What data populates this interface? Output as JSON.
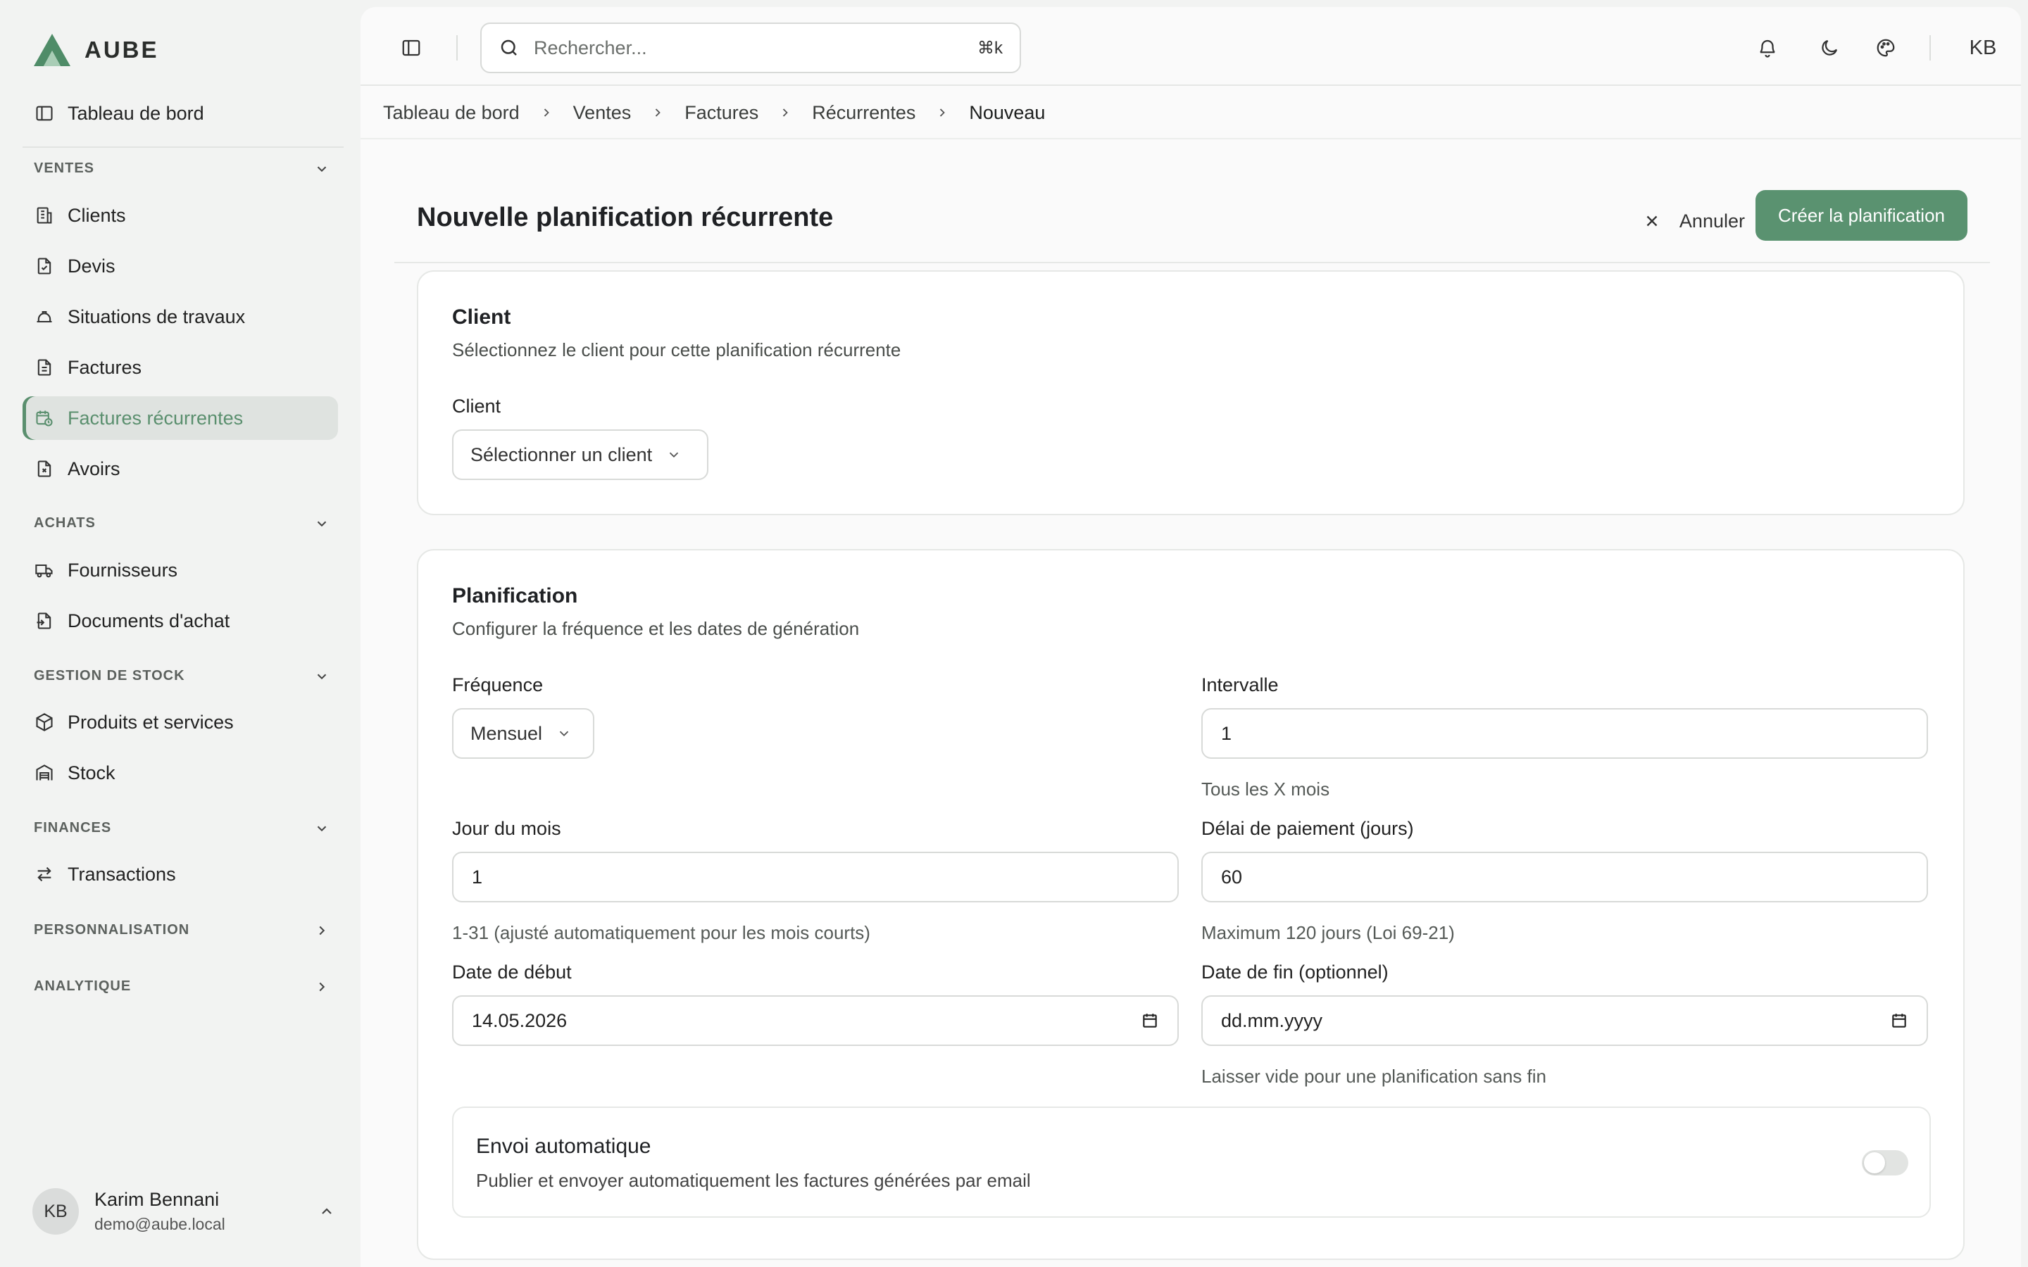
{
  "app": {
    "logo_text": "AUBE",
    "accent": "#5a9270"
  },
  "sidebar": {
    "top_item": "Tableau de bord",
    "sections": {
      "ventes": "VENTES",
      "achats": "ACHATS",
      "stock": "GESTION DE STOCK",
      "finances": "FINANCES",
      "perso": "PERSONNALISATION",
      "analytique": "ANALYTIQUE"
    },
    "items": {
      "clients": "Clients",
      "devis": "Devis",
      "situations": "Situations de travaux",
      "factures": "Factures",
      "recurrentes": "Factures récurrentes",
      "avoirs": "Avoirs",
      "fournisseurs": "Fournisseurs",
      "documents": "Documents d'achat",
      "produits": "Produits et services",
      "stock": "Stock",
      "transactions": "Transactions"
    },
    "user": {
      "initials": "KB",
      "name": "Karim Bennani",
      "email": "demo@aube.local"
    }
  },
  "topbar": {
    "search_placeholder": "Rechercher...",
    "shortcut": "⌘k",
    "user_initials": "KB"
  },
  "breadcrumb": [
    "Tableau de bord",
    "Ventes",
    "Factures",
    "Récurrentes",
    "Nouveau"
  ],
  "page": {
    "title": "Nouvelle planification récurrente",
    "cancel_label": "Annuler",
    "create_label": "Créer la planification"
  },
  "client_card": {
    "title": "Client",
    "subtitle": "Sélectionnez le client pour cette planification récurrente",
    "field_label": "Client",
    "select_value": "Sélectionner un client"
  },
  "plan_card": {
    "title": "Planification",
    "subtitle": "Configurer la fréquence et les dates de génération",
    "frequency_label": "Fréquence",
    "frequency_value": "Mensuel",
    "interval_label": "Intervalle",
    "interval_value": "1",
    "interval_hint": "Tous les X mois",
    "day_label": "Jour du mois",
    "day_value": "1",
    "day_hint": "1-31 (ajusté automatiquement pour les mois courts)",
    "delay_label": "Délai de paiement (jours)",
    "delay_value": "60",
    "delay_hint": "Maximum 120 jours (Loi 69-21)",
    "start_label": "Date de début",
    "start_value": "14.05.2026",
    "end_label": "Date de fin (optionnel)",
    "end_value": "dd.mm.yyyy",
    "end_hint": "Laisser vide pour une planification sans fin",
    "auto_title": "Envoi automatique",
    "auto_subtitle": "Publier et envoyer automatiquement les factures générées par email",
    "auto_enabled": false
  }
}
